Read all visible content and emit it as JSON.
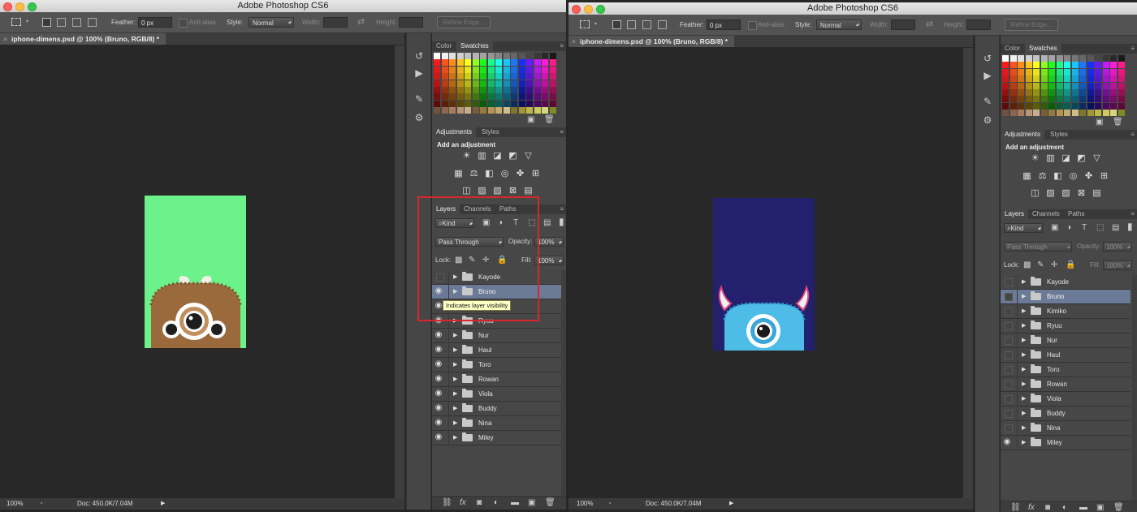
{
  "left": {
    "app_title": "Adobe Photoshop CS6",
    "options": {
      "feather_label": "Feather:",
      "feather_value": "0 px",
      "antialias_label": "Anti-alias",
      "style_label": "Style:",
      "style_value": "Normal",
      "width_label": "Width:",
      "height_label": "Height:",
      "refine_edge": "Refine Edge..."
    },
    "doc_tab": "iphone-dimens.psd @ 100% (Bruno, RGB/8) *",
    "artwork": {
      "background": "#6cf28a",
      "character": "Bruno (brown furry monster, 3 eyes)"
    },
    "status": {
      "zoom": "100%",
      "doc": "Doc: 450.0K/7.04M"
    },
    "swatch_tabs": [
      "Color",
      "Swatches"
    ],
    "adjust_tabs": [
      "Adjustments",
      "Styles"
    ],
    "add_adjustment": "Add an adjustment",
    "layer_tabs": [
      "Layers",
      "Channels",
      "Paths"
    ],
    "kind_label": "Kind",
    "blend_mode": "Pass Through",
    "opacity_label": "Opacity:",
    "opacity_value": "100%",
    "lock_label": "Lock:",
    "fill_label": "Fill:",
    "fill_value": "100%",
    "tooltip": "Indicates layer visibility",
    "highlight_color": "#d9262b",
    "selected_layer": "Bruno",
    "layers": [
      {
        "name": "Kayode",
        "visible": false
      },
      {
        "name": "Bruno",
        "visible": true
      },
      {
        "name": "Kimiko",
        "visible": true
      },
      {
        "name": "Ryuu",
        "visible": true
      },
      {
        "name": "Nur",
        "visible": true
      },
      {
        "name": "Haul",
        "visible": true
      },
      {
        "name": "Toro",
        "visible": true
      },
      {
        "name": "Rowan",
        "visible": true
      },
      {
        "name": "Viola",
        "visible": true
      },
      {
        "name": "Buddy",
        "visible": true
      },
      {
        "name": "Nina",
        "visible": true
      },
      {
        "name": "Miley",
        "visible": true
      }
    ]
  },
  "right": {
    "app_title": "Adobe Photoshop CS6",
    "options": {
      "feather_label": "Feather:",
      "feather_value": "0 px",
      "antialias_label": "Anti-alias",
      "style_label": "Style:",
      "style_value": "Normal",
      "width_label": "Width:",
      "height_label": "Height:",
      "refine_edge": "Refine Edge..."
    },
    "doc_tab": "iphone-dimens.psd @ 100% (Bruno, RGB/8) *",
    "artwork": {
      "background": "#23206e",
      "character": "Miley (blue furry monster, 1 eye)"
    },
    "status": {
      "zoom": "100%",
      "doc": "Doc: 450.0K/7.04M"
    },
    "swatch_tabs": [
      "Color",
      "Swatches"
    ],
    "adjust_tabs": [
      "Adjustments",
      "Styles"
    ],
    "add_adjustment": "Add an adjustment",
    "layer_tabs": [
      "Layers",
      "Channels",
      "Paths"
    ],
    "kind_label": "Kind",
    "blend_mode": "Pass Through",
    "opacity_label": "Opacity:",
    "opacity_value": "100%",
    "lock_label": "Lock:",
    "fill_label": "Fill:",
    "fill_value": "100%",
    "selected_layer": "Bruno",
    "layers": [
      {
        "name": "Kayode",
        "visible": false
      },
      {
        "name": "Bruno",
        "visible": false
      },
      {
        "name": "Kimiko",
        "visible": false
      },
      {
        "name": "Ryuu",
        "visible": false
      },
      {
        "name": "Nur",
        "visible": false
      },
      {
        "name": "Haul",
        "visible": false
      },
      {
        "name": "Toro",
        "visible": false
      },
      {
        "name": "Rowan",
        "visible": false
      },
      {
        "name": "Viola",
        "visible": false
      },
      {
        "name": "Buddy",
        "visible": false
      },
      {
        "name": "Nina",
        "visible": false
      },
      {
        "name": "Miley",
        "visible": true
      }
    ]
  }
}
